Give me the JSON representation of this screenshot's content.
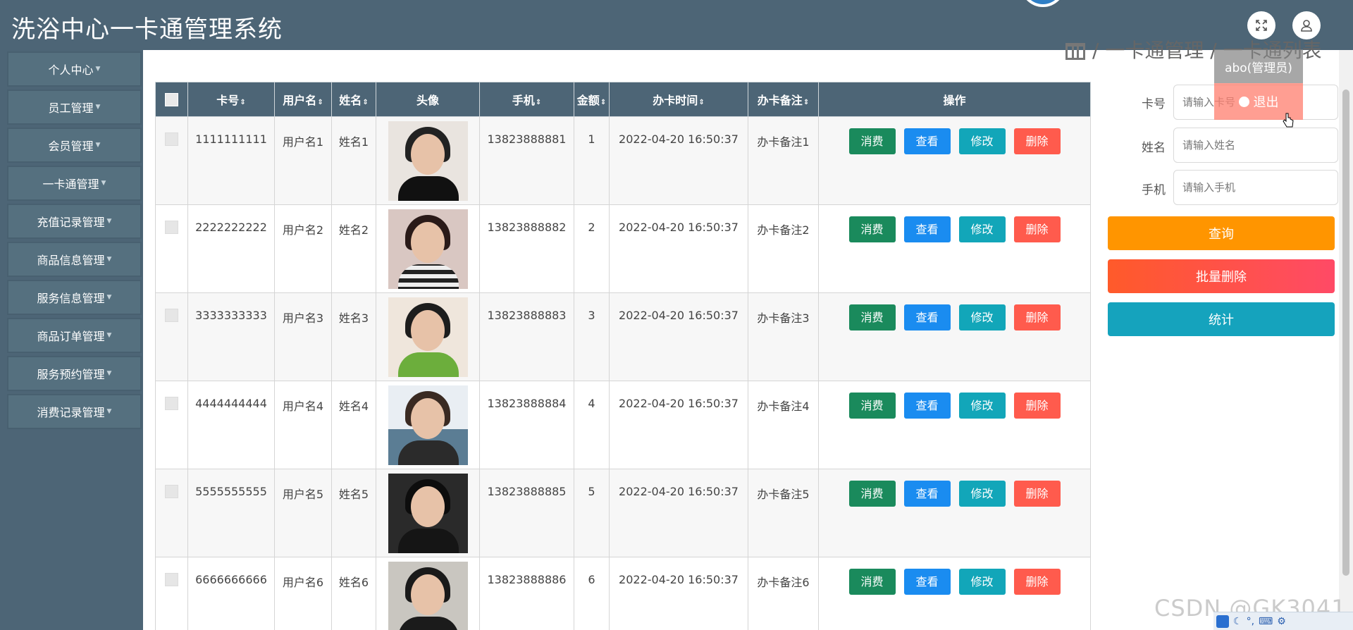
{
  "app": {
    "title": "洗浴中心一卡通管理系统"
  },
  "header": {
    "fullscreen_icon": "expand-icon",
    "user_icon": "user-icon"
  },
  "sidebar": {
    "items": [
      {
        "label": "个人中心"
      },
      {
        "label": "员工管理"
      },
      {
        "label": "会员管理"
      },
      {
        "label": "一卡通管理"
      },
      {
        "label": "充值记录管理"
      },
      {
        "label": "商品信息管理"
      },
      {
        "label": "服务信息管理"
      },
      {
        "label": "商品订单管理"
      },
      {
        "label": "服务预约管理"
      },
      {
        "label": "消费记录管理"
      }
    ]
  },
  "breadcrumb": {
    "text": "/   一卡通管理  /  一卡通列表"
  },
  "table": {
    "headers": {
      "card_no": "卡号",
      "username": "用户名",
      "name": "姓名",
      "avatar": "头像",
      "phone": "手机",
      "amount": "金额",
      "time": "办卡时间",
      "note": "办卡备注",
      "actions": "操作"
    },
    "sort_glyph": "⇕",
    "rows": [
      {
        "card_no": "1111111111",
        "username": "用户名1",
        "name": "姓名1",
        "phone": "13823888881",
        "amount": "1",
        "time": "2022-04-20 16:50:37",
        "note": "办卡备注1"
      },
      {
        "card_no": "2222222222",
        "username": "用户名2",
        "name": "姓名2",
        "phone": "13823888882",
        "amount": "2",
        "time": "2022-04-20 16:50:37",
        "note": "办卡备注2"
      },
      {
        "card_no": "3333333333",
        "username": "用户名3",
        "name": "姓名3",
        "phone": "13823888883",
        "amount": "3",
        "time": "2022-04-20 16:50:37",
        "note": "办卡备注3"
      },
      {
        "card_no": "4444444444",
        "username": "用户名4",
        "name": "姓名4",
        "phone": "13823888884",
        "amount": "4",
        "time": "2022-04-20 16:50:37",
        "note": "办卡备注4"
      },
      {
        "card_no": "5555555555",
        "username": "用户名5",
        "name": "姓名5",
        "phone": "13823888885",
        "amount": "5",
        "time": "2022-04-20 16:50:37",
        "note": "办卡备注5"
      },
      {
        "card_no": "6666666666",
        "username": "用户名6",
        "name": "姓名6",
        "phone": "13823888886",
        "amount": "6",
        "time": "2022-04-20 16:50:37",
        "note": "办卡备注6"
      }
    ],
    "action_labels": {
      "consume": "消费",
      "view": "查看",
      "edit": "修改",
      "delete": "删除"
    }
  },
  "search": {
    "card_label": "卡号",
    "card_placeholder": "请输入卡号",
    "name_label": "姓名",
    "name_placeholder": "请输入姓名",
    "phone_label": "手机",
    "phone_placeholder": "请输入手机",
    "query_button": "查询",
    "batch_delete_button": "批量删除",
    "stats_button": "统计"
  },
  "user_menu": {
    "user": "abo(管理员)",
    "logout": "退出"
  },
  "watermark": "CSDN @GK3041",
  "colors": {
    "header": "#4d6576",
    "consume": "#1a8a5c",
    "view": "#1a8cf0",
    "edit": "#12a6b9",
    "delete": "#ff5b4d",
    "query": "#ff9500",
    "stats": "#15a3bd"
  }
}
